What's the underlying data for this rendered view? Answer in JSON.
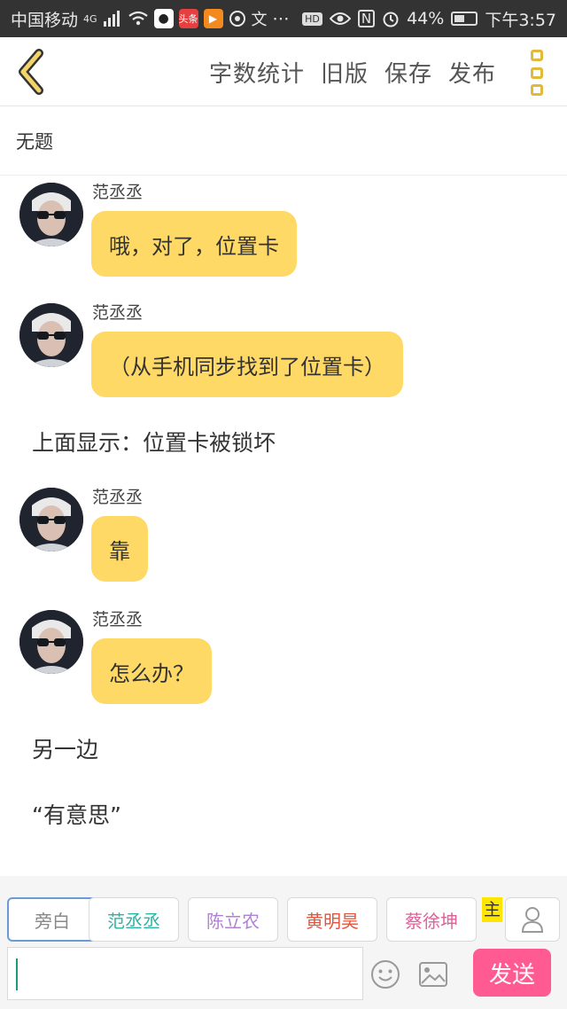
{
  "status_bar": {
    "carrier": "中国移动",
    "network": "4G",
    "app_badge": "头条",
    "battery": "44%",
    "time": "下午3:57"
  },
  "toolbar": {
    "word_count_label": "字数统计",
    "old_version_label": "旧版",
    "save_label": "保存",
    "publish_label": "发布",
    "accent_color": "#e2b93b"
  },
  "title": "无题",
  "messages": [
    {
      "type": "bubble",
      "sender": "范丞丞",
      "text": "哦，对了，位置卡"
    },
    {
      "type": "bubble",
      "sender": "范丞丞",
      "text": "（从手机同步找到了位置卡）"
    },
    {
      "type": "narration",
      "text": "上面显示：位置卡被锁坏"
    },
    {
      "type": "bubble",
      "sender": "范丞丞",
      "text": "靠"
    },
    {
      "type": "bubble",
      "sender": "范丞丞",
      "text": "怎么办？"
    },
    {
      "type": "narration",
      "text": "另一边"
    },
    {
      "type": "narration",
      "text": "“有意思”"
    }
  ],
  "bubble_color": "#ffd966",
  "roles": [
    {
      "name": "旁白",
      "color": "#888888",
      "selected": true
    },
    {
      "name": "范丞丞",
      "color": "#2bb3a3",
      "selected": false
    },
    {
      "name": "陈立农",
      "color": "#b07fd6",
      "selected": false
    },
    {
      "name": "黄明昊",
      "color": "#e0563f",
      "selected": false
    },
    {
      "name": "蔡徐坤",
      "color": "#e0609a",
      "selected": false
    }
  ],
  "main_tag": "主",
  "send_label": "发送",
  "send_color": "#ff5b92",
  "icons": [
    "back-arrow-icon",
    "more-icon",
    "person-icon",
    "emoji-icon",
    "image-icon"
  ]
}
